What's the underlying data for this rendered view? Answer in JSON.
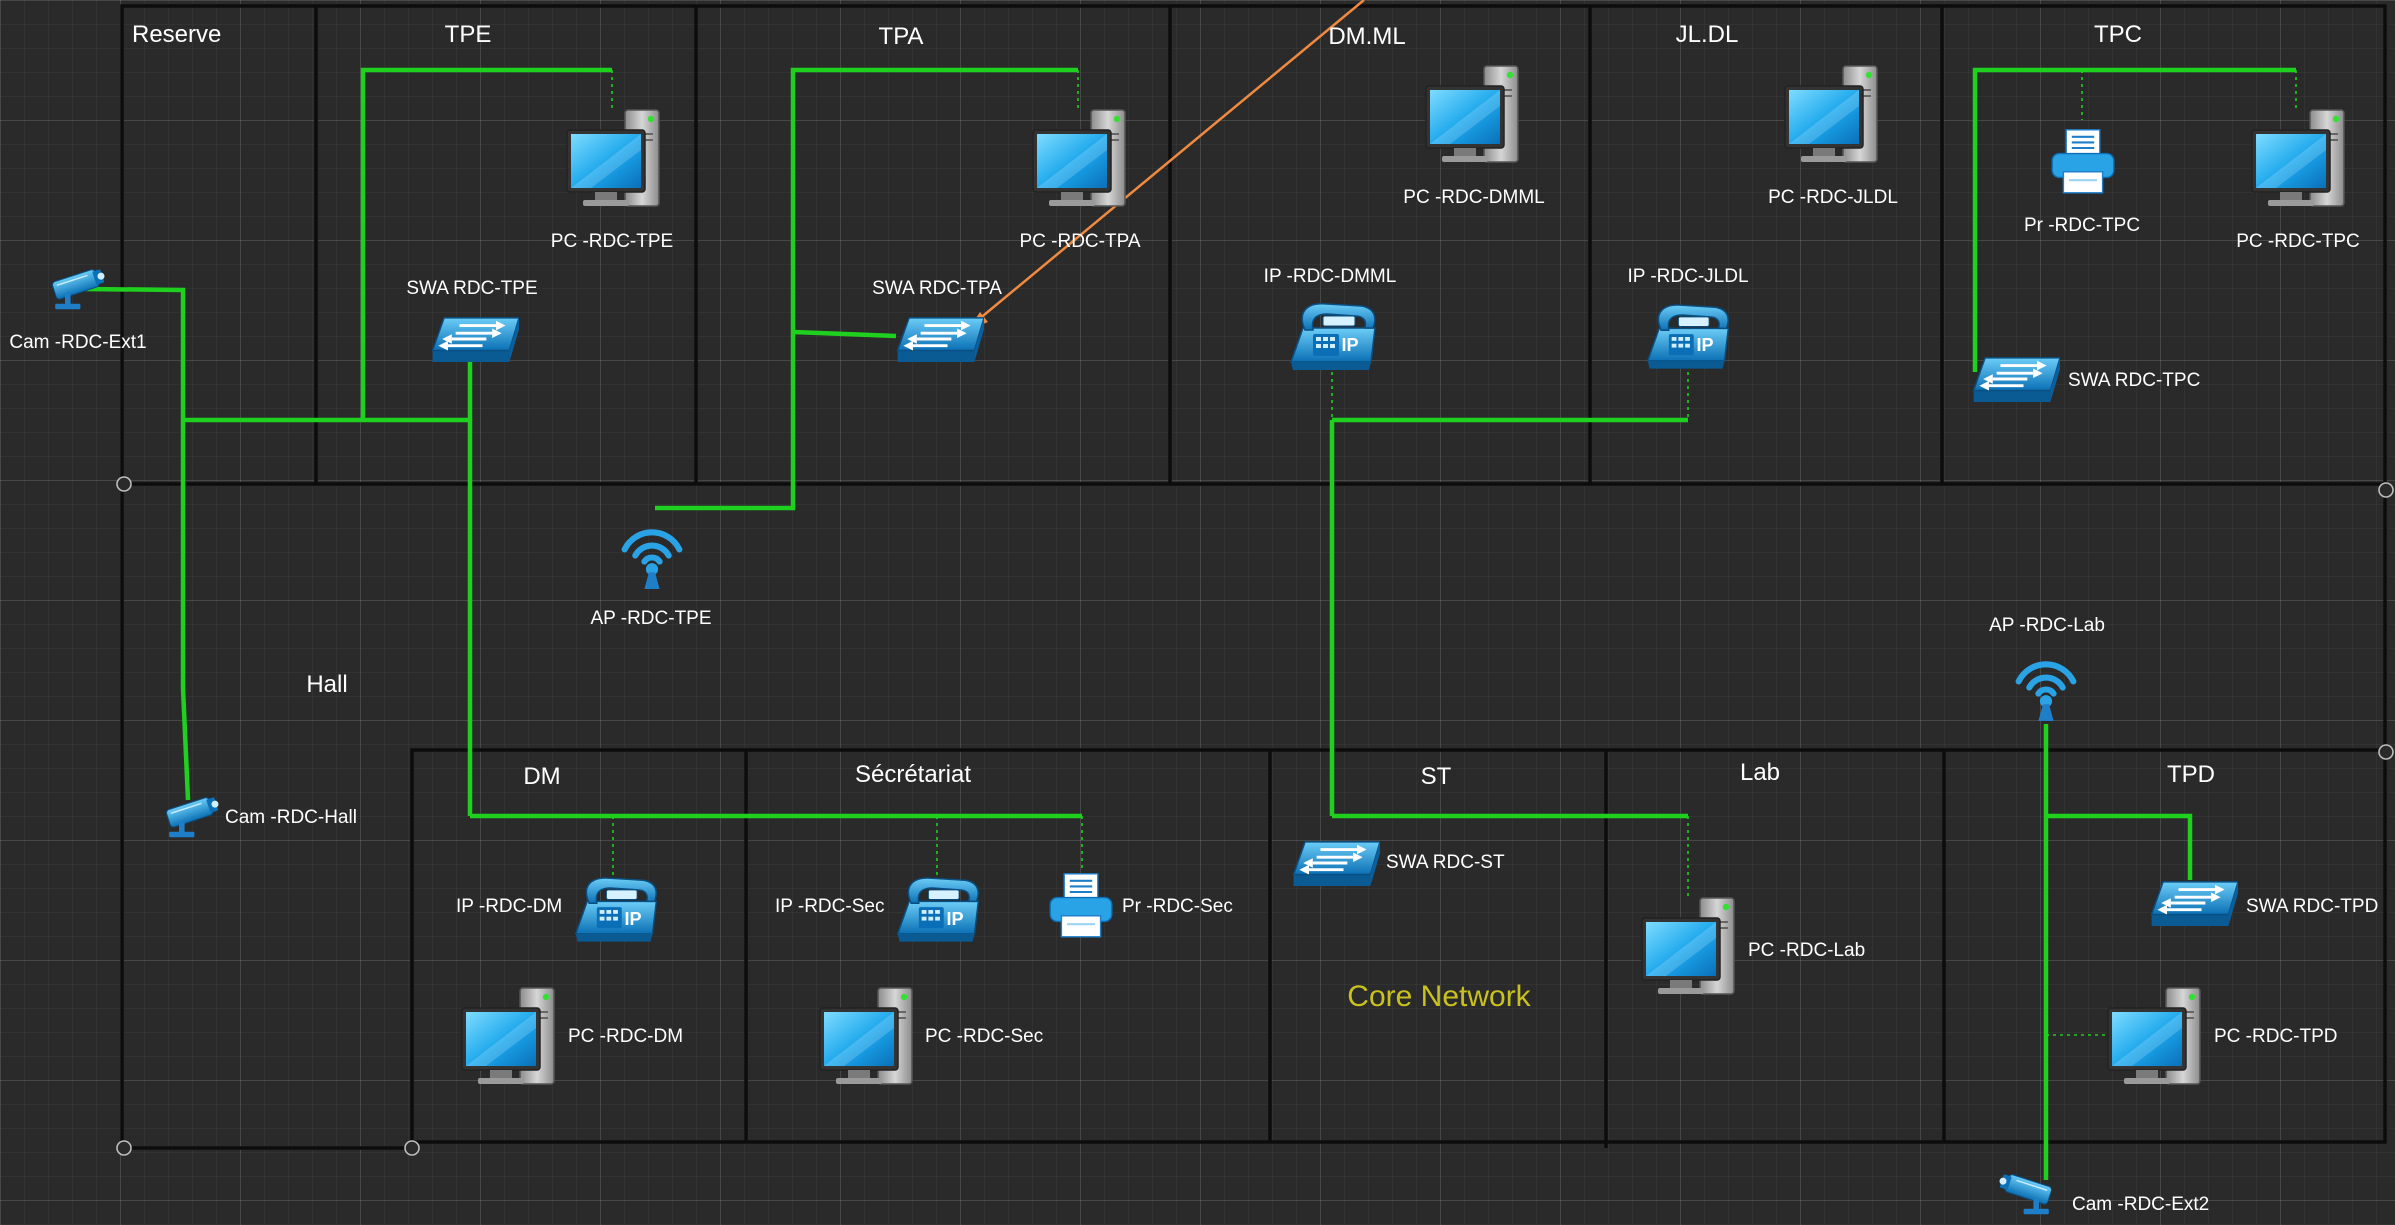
{
  "rooms": {
    "reserve": "Reserve",
    "tpe": "TPE",
    "tpa": "TPA",
    "dmml": "DM.ML",
    "jldl": "JL.DL",
    "tpc": "TPC",
    "hall": "Hall",
    "dm": "DM",
    "secretariat": "Sécrétariat",
    "st": "ST",
    "lab": "Lab",
    "tpd": "TPD"
  },
  "core_label": "Core Network",
  "devices": {
    "pc_tpe": "PC -RDC-TPE",
    "pc_tpa": "PC -RDC-TPA",
    "pc_dmml": "PC -RDC-DMML",
    "pc_jldl": "PC -RDC-JLDL",
    "pc_tpc": "PC -RDC-TPC",
    "pr_tpc": "Pr -RDC-TPC",
    "swa_tpe": "SWA RDC-TPE",
    "swa_tpa": "SWA RDC-TPA",
    "swa_tpc": "SWA RDC-TPC",
    "ip_dmml": "IP -RDC-DMML",
    "ip_jldl": "IP -RDC-JLDL",
    "cam_ext1": "Cam -RDC-Ext1",
    "ap_tpe": "AP -RDC-TPE",
    "ap_lab": "AP -RDC-Lab",
    "cam_hall": "Cam -RDC-Hall",
    "ip_dm": "IP -RDC-DM",
    "ip_sec": "IP -RDC-Sec",
    "pr_sec": "Pr -RDC-Sec",
    "swa_st": "SWA RDC-ST",
    "swa_tpd": "SWA RDC-TPD",
    "pc_dm": "PC -RDC-DM",
    "pc_sec": "PC -RDC-Sec",
    "pc_lab": "PC -RDC-Lab",
    "pc_tpd": "PC -RDC-TPD",
    "cam_ext2": "Cam -RDC-Ext2",
    "ip_badge": "IP"
  },
  "colors": {
    "link": "#1fd01f",
    "wall": "#0c0c0c",
    "background": "#2a2a2a",
    "core_label": "#c9c21e",
    "annotation_arrow": "#f08a40",
    "device_blue": "#2aa3e6"
  }
}
